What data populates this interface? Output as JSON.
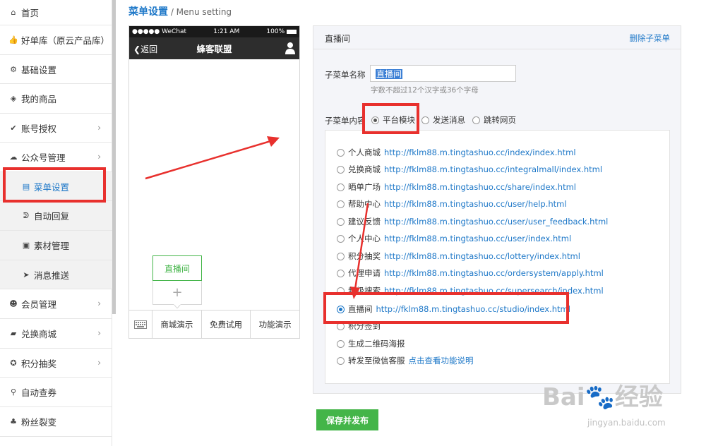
{
  "sidebar": {
    "items": [
      {
        "label": "首页",
        "icon": "home-icon",
        "glyph": "⌂"
      },
      {
        "label": "好单库（原云产品库）",
        "icon": "thumbs-up-icon",
        "glyph": "👍"
      },
      {
        "label": "基础设置",
        "icon": "gear-icon",
        "glyph": "⚙"
      },
      {
        "label": "我的商品",
        "icon": "cube-icon",
        "glyph": "◈"
      },
      {
        "label": "账号授权",
        "icon": "check-circle-icon",
        "glyph": "✔"
      },
      {
        "label": "公众号管理",
        "icon": "wechat-icon",
        "glyph": "☁"
      },
      {
        "label": "菜单设置",
        "icon": "menu-list-icon",
        "glyph": "▤"
      },
      {
        "label": "自动回复",
        "icon": "rss-icon",
        "glyph": "ᕲ"
      },
      {
        "label": "素材管理",
        "icon": "image-icon",
        "glyph": "▣"
      },
      {
        "label": "消息推送",
        "icon": "rocket-icon",
        "glyph": "➤"
      },
      {
        "label": "会员管理",
        "icon": "users-icon",
        "glyph": "☻"
      },
      {
        "label": "兑换商城",
        "icon": "shopping-bag-icon",
        "glyph": "▰"
      },
      {
        "label": "积分抽奖",
        "icon": "lottery-icon",
        "glyph": "✪"
      },
      {
        "label": "自动查券",
        "icon": "search-icon",
        "glyph": "⚲"
      },
      {
        "label": "粉丝裂变",
        "icon": "sitemap-icon",
        "glyph": "♣"
      }
    ]
  },
  "page": {
    "title_cn": "菜单设置",
    "title_sep": " / ",
    "title_en": "Menu setting"
  },
  "phone": {
    "carrier": "●●●●● WeChat",
    "time": "1:21 AM",
    "battery": "100%",
    "back_label": "返回",
    "nav_title": "蜂客联盟",
    "popup_item": "直播间",
    "add_glyph": "+",
    "bottom_menu": [
      "商城演示",
      "免费试用",
      "功能演示"
    ]
  },
  "panel": {
    "header": "直播间",
    "delete_link": "删除子菜单",
    "name_label": "子菜单名称",
    "name_value": "直播间",
    "name_hint": "字数不超过12个汉字或36个字母",
    "content_label": "子菜单内容",
    "content_types": [
      {
        "label": "平台模块",
        "selected": true
      },
      {
        "label": "发送消息",
        "selected": false
      },
      {
        "label": "跳转网页",
        "selected": false
      }
    ],
    "options": [
      {
        "label": "个人商城",
        "url": "http://fklm88.m.tingtashuo.cc/index/index.html",
        "selected": false
      },
      {
        "label": "兑换商城",
        "url": "http://fklm88.m.tingtashuo.cc/integralmall/index.html",
        "selected": false
      },
      {
        "label": "晒单广场",
        "url": "http://fklm88.m.tingtashuo.cc/share/index.html",
        "selected": false
      },
      {
        "label": "帮助中心",
        "url": "http://fklm88.m.tingtashuo.cc/user/help.html",
        "selected": false
      },
      {
        "label": "建议反馈",
        "url": "http://fklm88.m.tingtashuo.cc/user/user_feedback.html",
        "selected": false
      },
      {
        "label": "个人中心",
        "url": "http://fklm88.m.tingtashuo.cc/user/index.html",
        "selected": false
      },
      {
        "label": "积分抽奖",
        "url": "http://fklm88.m.tingtashuo.cc/lottery/index.html",
        "selected": false
      },
      {
        "label": "代理申请",
        "url": "http://fklm88.m.tingtashuo.cc/ordersystem/apply.html",
        "selected": false
      },
      {
        "label": "超级搜索",
        "url": "http://fklm88.m.tingtashuo.cc/supersearch/index.html",
        "selected": false
      },
      {
        "label": "直播间",
        "url": "http://fklm88.m.tingtashuo.cc/studio/index.html",
        "selected": true
      },
      {
        "label": "积分签到",
        "url": "",
        "selected": false
      },
      {
        "label": "生成二维码海报",
        "url": "",
        "selected": false
      },
      {
        "label": "转发至微信客服",
        "url": "点击查看功能说明",
        "selected": false
      }
    ],
    "save_label": "保存并发布"
  },
  "watermark": {
    "main": "Bai🐾经验",
    "sub": "jingyan.baidu.com"
  },
  "colors": {
    "accent": "#1e78c8",
    "green": "#44b549",
    "annotation": "#e8302d"
  }
}
